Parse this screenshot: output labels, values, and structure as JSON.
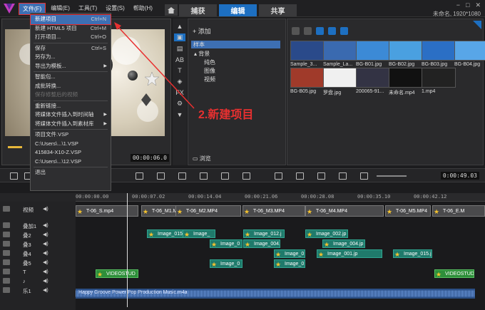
{
  "menubar": {
    "items": [
      "文件(F)",
      "编辑(E)",
      "工具(T)",
      "设置(S)",
      "帮助(H)"
    ]
  },
  "tabs": [
    "捕获",
    "编辑",
    "共享"
  ],
  "window": {
    "project_info": "未命名, 1920*1080",
    "min": "−",
    "max": "□",
    "close": "✕"
  },
  "file_menu": {
    "items": [
      {
        "label": "新建项目",
        "shortcut": "Ctrl+N",
        "highlighted": true
      },
      {
        "label": "新建 HTML5 项目",
        "shortcut": "Ctrl+M"
      },
      {
        "label": "打开项目...",
        "shortcut": "Ctrl+O"
      },
      {
        "label": "保存",
        "shortcut": "Ctrl+S"
      },
      {
        "label": "另存为..."
      },
      {
        "label": "导出为模板...",
        "submenu": true
      },
      {
        "label": "智能包..."
      },
      {
        "label": "成批转换..."
      },
      {
        "label": "保存修整后的视频",
        "disabled": true
      },
      {
        "label": "重新链接..."
      },
      {
        "label": "将媒体文件插入到时间轴",
        "submenu": true
      },
      {
        "label": "将媒体文件插入到素材库",
        "submenu": true
      },
      {
        "label": "项目文件.VSP"
      },
      {
        "label": "C:\\Users\\...\\1.VSP"
      },
      {
        "label": "415834-X10-Z.VSP"
      },
      {
        "label": "C:\\Users\\...\\12.VSP"
      },
      {
        "label": "退出"
      }
    ]
  },
  "annotation": {
    "text": "2.新建项目",
    "color": "#e83030"
  },
  "library": {
    "add_label": "添加",
    "tree": [
      "样本",
      "背景",
      "纯色",
      "图像",
      "视频"
    ],
    "browse_label": "浏览",
    "thumbnails": [
      {
        "label": "Sample_3..."
      },
      {
        "label": "Sample_La..."
      },
      {
        "label": "BG-B01.jpg"
      },
      {
        "label": "BG-B02.jpg"
      },
      {
        "label": "BG-B03.jpg"
      },
      {
        "label": "BG-B04.jpg"
      },
      {
        "label": "BG-B05.jpg"
      },
      {
        "label": "罗盘.jpg"
      },
      {
        "label": "200065-91..."
      },
      {
        "label": "未命名.mp4"
      },
      {
        "label": "1.mp4"
      }
    ]
  },
  "preview": {
    "timecode": "00:00:06.0"
  },
  "timeline": {
    "timecode": "0:00:49.03",
    "ruler": [
      "00:00:00.00",
      "00:00:07.02",
      "00:00:14.04",
      "00:00:21.06",
      "00:00:28.08",
      "00:00:35.10",
      "00:00:42.12"
    ],
    "tracks": [
      {
        "name": "视频"
      },
      {
        "name": "叠加1"
      },
      {
        "name": "叠2"
      },
      {
        "name": "叠3"
      },
      {
        "name": "叠4"
      },
      {
        "name": "叠5"
      },
      {
        "name": "T"
      },
      {
        "name": "♪"
      },
      {
        "name": "乐1"
      }
    ],
    "video_clips": [
      "T-06_S.mp4",
      "T-06_M1.MP",
      "T-06_M2.MP4",
      "T-06_M3.MP4",
      "T-06_M4.MP4",
      "T-06_M5.MP4",
      "T-06_E.M"
    ],
    "overlay_clips": [
      "Image_015.",
      "Image_",
      "Image_012.j",
      "Image_002.jp",
      "Image_0",
      "Image_004.j",
      "Image_004.jp",
      "Image_0",
      "Image_001.jp",
      "Image_015.j",
      "Image_0",
      "Image_0"
    ],
    "title_clips": [
      "VIDEOSTUD",
      "VIDEOSTUD"
    ],
    "audio_clip": "Happy Groove Power Pop Production Music.m4a"
  }
}
